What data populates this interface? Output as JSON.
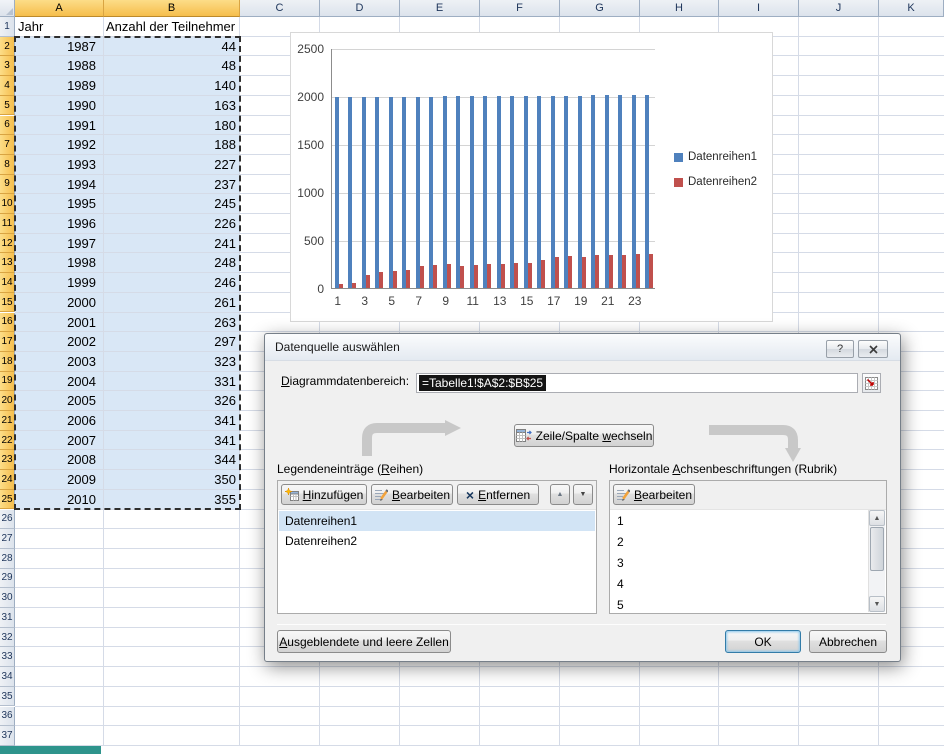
{
  "sheet": {
    "columns": [
      "A",
      "B",
      "C",
      "D",
      "E",
      "F",
      "G",
      "H",
      "I",
      "J",
      "K"
    ],
    "row_count": 37,
    "selection": {
      "columns": [
        "A",
        "B"
      ],
      "rows": [
        2,
        25
      ]
    },
    "table": {
      "headers": [
        "Jahr",
        "Anzahl der Teilnehmer"
      ],
      "data": [
        [
          1987,
          44
        ],
        [
          1988,
          48
        ],
        [
          1989,
          140
        ],
        [
          1990,
          163
        ],
        [
          1991,
          180
        ],
        [
          1992,
          188
        ],
        [
          1993,
          227
        ],
        [
          1994,
          237
        ],
        [
          1995,
          245
        ],
        [
          1996,
          226
        ],
        [
          1997,
          241
        ],
        [
          1998,
          248
        ],
        [
          1999,
          246
        ],
        [
          2000,
          261
        ],
        [
          2001,
          263
        ],
        [
          2002,
          297
        ],
        [
          2003,
          323
        ],
        [
          2004,
          331
        ],
        [
          2005,
          326
        ],
        [
          2006,
          341
        ],
        [
          2007,
          341
        ],
        [
          2008,
          344
        ],
        [
          2009,
          350
        ],
        [
          2010,
          355
        ]
      ]
    }
  },
  "chart_data": {
    "type": "bar",
    "title": "",
    "categories": [
      1,
      2,
      3,
      4,
      5,
      6,
      7,
      8,
      9,
      10,
      11,
      12,
      13,
      14,
      15,
      16,
      17,
      18,
      19,
      20,
      21,
      22,
      23,
      24
    ],
    "x_tick_labels": [
      "1",
      "3",
      "5",
      "7",
      "9",
      "11",
      "13",
      "15",
      "17",
      "19",
      "21",
      "23"
    ],
    "series": [
      {
        "name": "Datenreihen1",
        "color": "#4F81BD",
        "values": [
          1987,
          1988,
          1989,
          1990,
          1991,
          1992,
          1993,
          1994,
          1995,
          1996,
          1997,
          1998,
          1999,
          2000,
          2001,
          2002,
          2003,
          2004,
          2005,
          2006,
          2007,
          2008,
          2009,
          2010
        ]
      },
      {
        "name": "Datenreihen2",
        "color": "#C0504D",
        "values": [
          44,
          48,
          140,
          163,
          180,
          188,
          227,
          237,
          245,
          226,
          241,
          248,
          246,
          261,
          263,
          297,
          323,
          331,
          326,
          341,
          341,
          344,
          350,
          355
        ]
      }
    ],
    "ylim": [
      0,
      2500
    ],
    "y_ticks": [
      0,
      500,
      1000,
      1500,
      2000,
      2500
    ],
    "grid": true,
    "legend_position": "right"
  },
  "dialog": {
    "title": "Datenquelle auswählen",
    "help_label": "?",
    "range_label": "Diagrammdatenbereich:",
    "range_accel": "D",
    "range_value": "=Tabelle1!$A$2:$B$25",
    "switch_button": "Zeile/Spalte wechseln",
    "switch_accel": "w",
    "legend_group_label": "Legendeneinträge (Reihen)",
    "legend_group_accel": "R",
    "axis_group_label": "Horizontale Achsenbeschriftungen (Rubrik)",
    "axis_group_accel": "A",
    "add_button": "Hinzufügen",
    "add_accel": "H",
    "edit_button": "Bearbeiten",
    "edit_accel": "B",
    "remove_button": "Entfernen",
    "remove_accel": "E",
    "axis_edit_button": "Bearbeiten",
    "axis_edit_accel": "B",
    "series_items": [
      "Datenreihen1",
      "Datenreihen2"
    ],
    "selected_series": "Datenreihen1",
    "axis_items": [
      "1",
      "2",
      "3",
      "4",
      "5"
    ],
    "hidden_cells_button": "Ausgeblendete und leere Zellen",
    "hidden_accel": "A",
    "ok_button": "OK",
    "cancel_button": "Abbrechen"
  },
  "icons": {
    "up_arrow": "▲",
    "down_arrow": "▼",
    "remove_x": "×"
  },
  "colors": {
    "series1": "#4F81BD",
    "series2": "#C0504D",
    "selection_fill": "#D9E7F6",
    "selected_header": "#F8C75B",
    "gridline": "#D5DBE7",
    "bottom_strip": "#2E948C"
  }
}
